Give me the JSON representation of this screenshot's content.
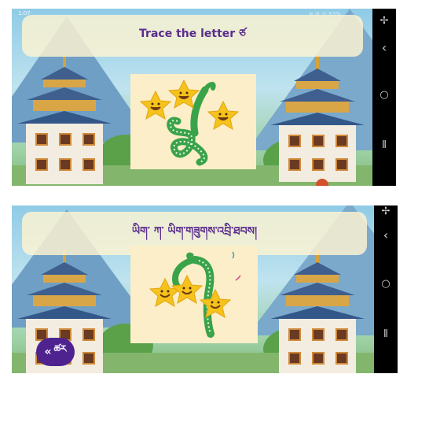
{
  "screen_one": {
    "status": {
      "time": "1:07",
      "right": "⊛ ⊞ ⦿ 63%"
    },
    "instruction": "Trace the letter ཙ",
    "system_nav": {
      "accessibility": "✢",
      "back": "‹",
      "home": "○",
      "recents": "⦀"
    }
  },
  "screen_two": {
    "instruction": "ཡིག་ ཀ་ ཡིག་གཟུགས་འབྲི་ཐབས།",
    "back_button": {
      "chevron": "«",
      "label": "ཚར"
    },
    "system_nav": {
      "accessibility": "✢",
      "back": "‹",
      "home": "○",
      "recents": "⦀"
    }
  },
  "colors": {
    "banner_text": "#5a2d8c",
    "button_bg": "#4e2390",
    "card_bg": "#fbeec8",
    "trace_green": "#3aa34a",
    "star": "#f6c21c"
  },
  "icons": [
    "accessibility-icon",
    "back-nav-icon",
    "home-nav-icon",
    "recents-nav-icon",
    "star-character-icon",
    "letter-tracing-glyph"
  ]
}
